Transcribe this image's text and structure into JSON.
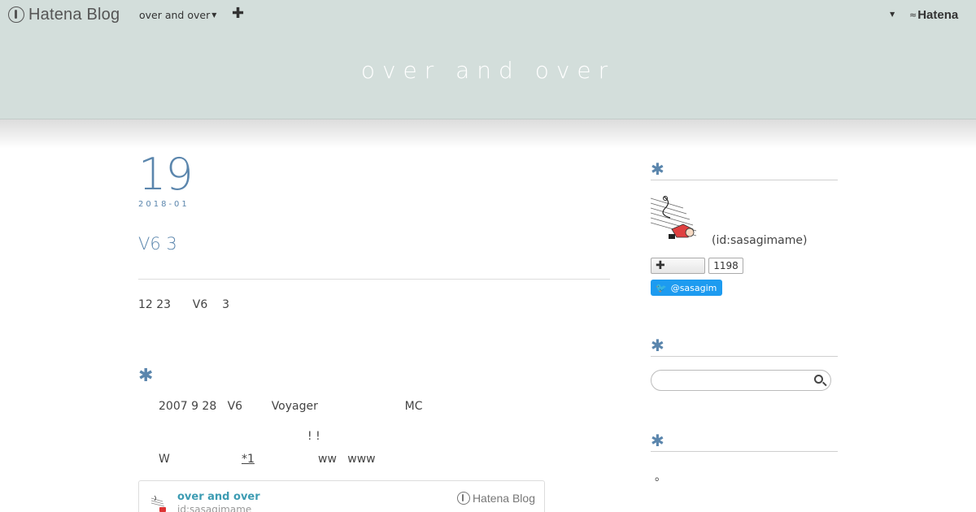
{
  "globalbar": {
    "logo_text": "Hatena Blog",
    "blog_switch": "over and over",
    "add_label": "✚",
    "brand": "Hatena"
  },
  "header": {
    "blog_title": "over and over"
  },
  "entry": {
    "day": "19",
    "year_month": "2018-01",
    "title": "V6 3",
    "lead": "12 23      V6    3",
    "section_mark": "✱",
    "line1": "2007 9 28   V6        Voyager                        MC",
    "line2": "! !",
    "line3_start": "W",
    "footnote": "*1",
    "line3_end": "ww   www"
  },
  "embed": {
    "title": "over and over",
    "id": "id:sasagimame",
    "brand": "Hatena Blog"
  },
  "sidebar": {
    "section_mark": "✱",
    "profile_id": "(id:sasagimame)",
    "subscribe_label": "✚",
    "subscribe_count": "1198",
    "twitter_label": "@sasagim",
    "search_placeholder": "",
    "note": "。"
  },
  "colors": {
    "accent": "#5b86ad",
    "header_bg": "#d3dedb",
    "twitter": "#1d9bf0",
    "embed_title": "#3d9cb3"
  }
}
